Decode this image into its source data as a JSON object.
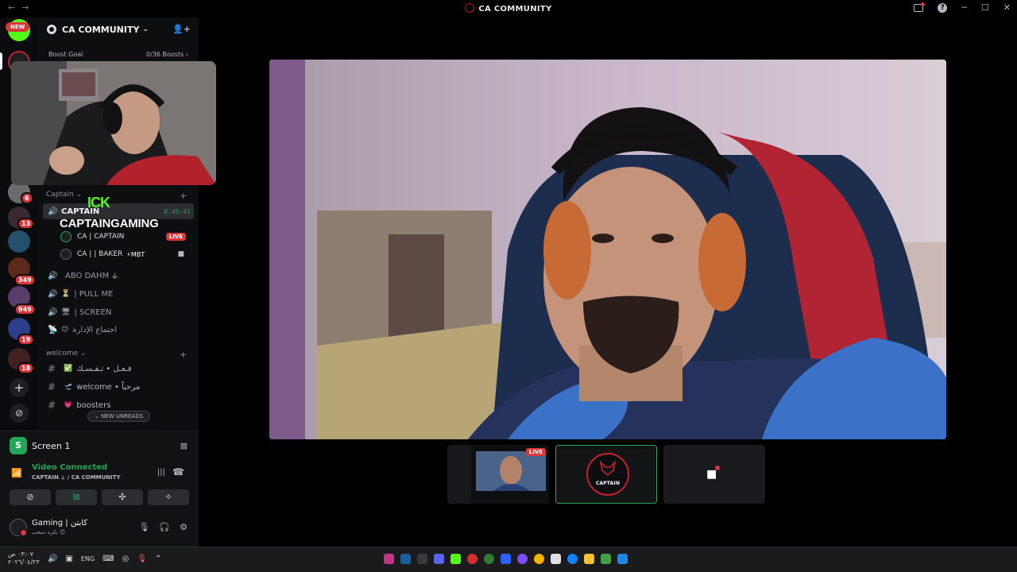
{
  "window": {
    "title": "CA COMMUNITY",
    "nav_back": "←",
    "nav_forward": "→",
    "help": "?",
    "minimize": "─",
    "maximize": "☐",
    "close": "✕"
  },
  "rail": {
    "new_label": "NEW",
    "badges": [
      "6",
      "13",
      "349",
      "949",
      "19",
      "18"
    ],
    "add_server": "+",
    "discover": "⊘"
  },
  "guild": {
    "name": "CA COMMUNITY",
    "chevron": "⌄",
    "invite_icon": "👤+",
    "boost_label": "Boost Goal",
    "boost_value": "0/36 Boosts ›"
  },
  "overlay": {
    "kick_text": "ICK",
    "streamer_name": "CAPTAINGAMING"
  },
  "voice_category": {
    "label": "Captain ⌄",
    "plus": "+"
  },
  "voice_channels": {
    "active": {
      "name": "CAPTAIN",
      "time": "8:45:41"
    },
    "users": [
      {
        "name": "CA | CAPTAIN",
        "live": "LIVE"
      },
      {
        "name": "CA | | BAKER",
        "tag": "⚡MBT"
      }
    ],
    "others": [
      {
        "emoji": "",
        "name": "ABO DAHM ⚶"
      },
      {
        "emoji": "⏳",
        "name": "| PULL ME"
      },
      {
        "emoji": "🖥",
        "name": "| SCREEN"
      },
      {
        "emoji": "😊",
        "name": "اجتماع الإدارة"
      }
    ]
  },
  "text_category": {
    "label": "welcome ⌄",
    "plus": "+"
  },
  "text_channels": [
    {
      "emoji": "✅",
      "name": "فـعـل • تـفـسـك"
    },
    {
      "emoji": "🛫",
      "name": "welcome • مرحباً"
    },
    {
      "emoji": "💗",
      "name": "boosters"
    }
  ],
  "new_unreads": "⌄ NEW UNREADS",
  "voice_panel": {
    "screen_label": "Screen 1",
    "status": "Video Connected",
    "location": "CAPTAIN ⚶ / CA COMMUNITY",
    "user_name": "Gaming | كابتن",
    "user_status": "بكره سحب 😊"
  },
  "stage": {
    "tile_live": "LIVE",
    "logo_text": "CAPTAIN"
  },
  "taskbar": {
    "time": "٠٣:٠٧ ص",
    "date": "٢٠٢٦/٠٤/٢٣",
    "lang": "ENG"
  },
  "colors": {
    "accent_green": "#23a55a",
    "live_red": "#da373c",
    "brand_red": "#c8202e",
    "kick_green": "#53fc18"
  }
}
